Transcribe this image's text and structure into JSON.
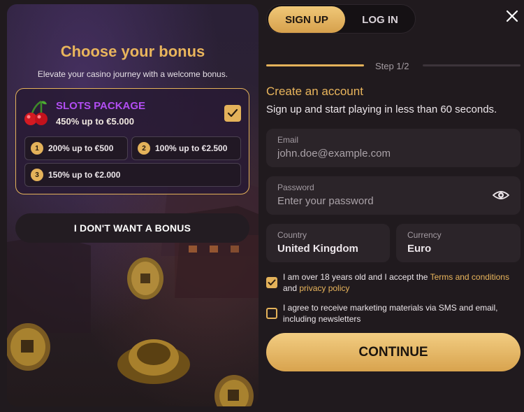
{
  "bonus_panel": {
    "title": "Choose your bonus",
    "subtitle": "Elevate your casino journey with a welcome bonus.",
    "package": {
      "name": "SLOTS PACKAGE",
      "amount": "450% up to €5.000",
      "selected": true
    },
    "tiers": [
      {
        "num": "1",
        "label": "200% up to €500"
      },
      {
        "num": "2",
        "label": "100% up to €2.500"
      },
      {
        "num": "3",
        "label": "150% up to €2.000"
      }
    ],
    "no_bonus_label": "I DON'T WANT A BONUS"
  },
  "auth": {
    "tabs": [
      {
        "label": "SIGN UP",
        "active": true
      },
      {
        "label": "LOG IN",
        "active": false
      }
    ],
    "step_text": "Step 1/2",
    "form_title": "Create an account",
    "form_subtitle": "Sign up and start playing in less than 60 seconds.",
    "email": {
      "label": "Email",
      "placeholder": "john.doe@example.com",
      "value": ""
    },
    "password": {
      "label": "Password",
      "placeholder": "Enter your password",
      "value": ""
    },
    "country": {
      "label": "Country",
      "value": "United Kingdom"
    },
    "currency": {
      "label": "Currency",
      "value": "Euro"
    },
    "age_consent": {
      "checked": true,
      "text_before": "I am over 18 years old and I accept the ",
      "terms_link": "Terms and conditions",
      "text_middle": " and ",
      "privacy_link": "privacy policy"
    },
    "marketing_consent": {
      "checked": false,
      "text": "I agree to receive marketing materials via SMS and email, including newsletters"
    },
    "continue_label": "CONTINUE"
  },
  "colors": {
    "accent": "#e4b25a",
    "package_name": "#b24df2",
    "background": "#201a1e"
  },
  "icons": [
    "cherry-icon",
    "check-icon",
    "close-icon",
    "eye-icon"
  ]
}
